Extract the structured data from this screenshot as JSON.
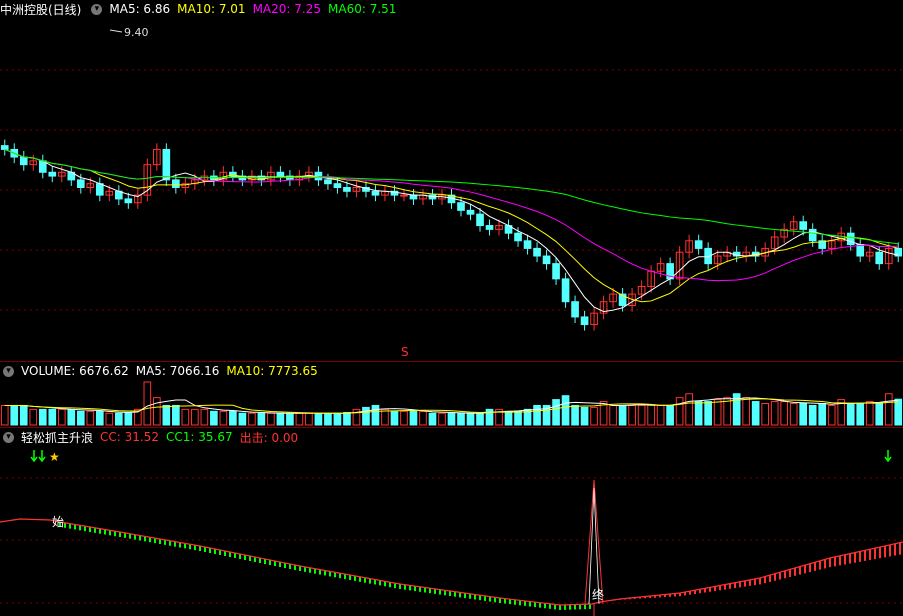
{
  "price_panel": {
    "title": "中洲控股(日线)",
    "ma_labels": [
      {
        "label": "MA5: 6.86",
        "color": "#ffffff"
      },
      {
        "label": "MA10: 7.01",
        "color": "#ffff00"
      },
      {
        "label": "MA20: 7.25",
        "color": "#ff00ff"
      },
      {
        "label": "MA60: 7.51",
        "color": "#00ff00"
      }
    ],
    "high_marker": "9.40",
    "s_marker": "S"
  },
  "volume_panel": {
    "labels": [
      {
        "label": "VOLUME: 6676.62",
        "color": "#ffffff"
      },
      {
        "label": "MA5: 7066.16",
        "color": "#ffffff"
      },
      {
        "label": "MA10: 7773.65",
        "color": "#ffff00"
      }
    ]
  },
  "indicator_panel": {
    "title": "轻松抓主升浪",
    "labels": [
      {
        "label": "CC: 31.52",
        "color": "#ff3333"
      },
      {
        "label": "CC1: 35.67",
        "color": "#00ff00"
      },
      {
        "label": "出击: 0.00",
        "color": "#ff3333"
      }
    ],
    "start_marker": "始",
    "end_marker": "终"
  },
  "colors": {
    "up": "#ff3232",
    "down": "#54ffff",
    "grid": "#800000",
    "ma5": "#ffffff",
    "ma10": "#ffff00",
    "ma20": "#ff00ff",
    "ma60": "#00ff00"
  },
  "chart_data": {
    "type": "candlestick",
    "closes": [
      7.9,
      7.8,
      7.7,
      7.75,
      7.6,
      7.55,
      7.6,
      7.5,
      7.4,
      7.45,
      7.3,
      7.35,
      7.25,
      7.2,
      7.3,
      7.7,
      7.9,
      7.5,
      7.4,
      7.45,
      7.5,
      7.55,
      7.5,
      7.6,
      7.55,
      7.5,
      7.55,
      7.5,
      7.6,
      7.55,
      7.5,
      7.55,
      7.6,
      7.5,
      7.45,
      7.4,
      7.35,
      7.4,
      7.35,
      7.3,
      7.35,
      7.3,
      7.3,
      7.25,
      7.3,
      7.25,
      7.3,
      7.2,
      7.1,
      7.05,
      6.9,
      6.85,
      6.9,
      6.8,
      6.7,
      6.6,
      6.5,
      6.4,
      6.2,
      5.9,
      5.7,
      5.6,
      5.75,
      5.9,
      6.0,
      5.85,
      6.0,
      6.1,
      6.3,
      6.4,
      6.2,
      6.55,
      6.7,
      6.6,
      6.4,
      6.5,
      6.55,
      6.5,
      6.55,
      6.5,
      6.6,
      6.75,
      6.85,
      6.95,
      6.85,
      6.7,
      6.6,
      6.7,
      6.8,
      6.65,
      6.5,
      6.55,
      6.4,
      6.6,
      6.5
    ],
    "volumes": [
      5,
      5,
      5,
      4,
      4,
      4,
      4,
      4,
      3.5,
      3.5,
      3.5,
      3,
      3,
      3.2,
      4,
      11,
      7,
      5,
      5,
      4,
      4,
      4,
      3.5,
      3.5,
      3.5,
      3,
      3,
      3,
      3,
      3,
      3,
      3,
      3,
      3,
      3,
      3,
      3.2,
      4,
      4.5,
      5,
      4,
      3.5,
      3.5,
      3.5,
      3.5,
      3,
      3,
      3,
      3,
      3,
      3,
      4,
      4,
      3.5,
      3.5,
      4,
      5,
      5,
      6.5,
      7.5,
      5,
      4.5,
      4.5,
      6,
      5,
      5,
      5,
      5,
      5.2,
      5,
      5,
      7,
      8,
      6,
      6,
      6.5,
      7,
      8,
      7,
      6,
      5.5,
      6,
      6,
      5.5,
      5.5,
      5,
      5.5,
      5,
      6.5,
      5.5,
      5.5,
      6,
      5.5,
      8,
      6.6
    ],
    "vol_unit": "thousand",
    "cc": [
      40,
      41,
      42,
      41.5,
      41,
      40,
      39,
      38,
      37,
      36,
      35,
      34,
      33,
      32,
      31,
      30,
      29,
      28,
      27,
      26,
      25,
      24,
      23,
      22,
      21,
      20,
      19,
      18,
      17,
      16,
      15,
      14,
      13,
      12,
      11,
      10,
      9,
      8,
      7,
      6,
      5,
      4,
      3,
      2,
      1,
      0.5,
      0.5,
      0.5,
      8,
      12,
      14,
      16,
      18,
      20,
      22,
      24,
      26,
      28,
      30,
      31,
      31.52
    ],
    "ylim": [
      5.2,
      9.6
    ]
  }
}
